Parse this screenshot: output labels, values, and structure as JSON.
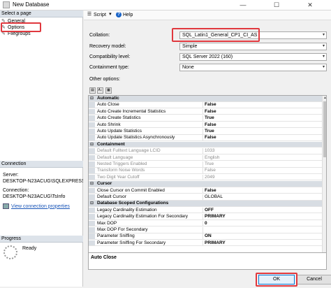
{
  "window": {
    "title": "New Database",
    "minimize": "—",
    "maximize": "☐",
    "close": "✕"
  },
  "sidebar": {
    "select_page_header": "Select a page",
    "pages": [
      {
        "label": "General"
      },
      {
        "label": "Options"
      },
      {
        "label": "Filegroups"
      }
    ],
    "connection_header": "Connection",
    "server_label": "Server:",
    "server_value": "DESKTOP-N23ACUG\\SQLEXPRESS",
    "connection_label": "Connection:",
    "connection_value": "DESKTOP-N23ACUG\\TsInfo",
    "view_connection_link": "View connection properties",
    "progress_header": "Progress",
    "progress_status": "Ready"
  },
  "toolbar": {
    "script_label": "Script",
    "help_label": "Help"
  },
  "fields": [
    {
      "label": "Collation:",
      "value": "SQL_Latin1_General_CP1_CI_AS"
    },
    {
      "label": "Recovery model:",
      "value": "Simple"
    },
    {
      "label": "Compatibility level:",
      "value": "SQL Server 2022 (160)"
    },
    {
      "label": "Containment type:",
      "value": "None"
    }
  ],
  "other_options_label": "Other options:",
  "property_grid": [
    {
      "type": "cat",
      "name": "Automatic"
    },
    {
      "type": "row",
      "name": "Auto Close",
      "value": "False",
      "bold": true
    },
    {
      "type": "row",
      "name": "Auto Create Incremental Statistics",
      "value": "False",
      "bold": true
    },
    {
      "type": "row",
      "name": "Auto Create Statistics",
      "value": "True",
      "bold": true
    },
    {
      "type": "row",
      "name": "Auto Shrink",
      "value": "False",
      "bold": true
    },
    {
      "type": "row",
      "name": "Auto Update Statistics",
      "value": "True",
      "bold": true
    },
    {
      "type": "row",
      "name": "Auto Update Statistics Asynchronously",
      "value": "False",
      "bold": true
    },
    {
      "type": "cat",
      "name": "Containment"
    },
    {
      "type": "row",
      "name": "Default Fulltext Language LCID",
      "value": "1033",
      "disabled": true
    },
    {
      "type": "row",
      "name": "Default Language",
      "value": "English",
      "disabled": true
    },
    {
      "type": "row",
      "name": "Nested Triggers Enabled",
      "value": "True",
      "disabled": true
    },
    {
      "type": "row",
      "name": "Transform Noise Words",
      "value": "False",
      "disabled": true
    },
    {
      "type": "row",
      "name": "Two Digit Year Cutoff",
      "value": "2049",
      "disabled": true
    },
    {
      "type": "cat",
      "name": "Cursor"
    },
    {
      "type": "row",
      "name": "Close Cursor on Commit Enabled",
      "value": "False",
      "bold": true
    },
    {
      "type": "row",
      "name": "Default Cursor",
      "value": "GLOBAL"
    },
    {
      "type": "cat",
      "name": "Database Scoped Configurations"
    },
    {
      "type": "row",
      "name": "Legacy Cardinality Estimation",
      "value": "OFF",
      "bold": true
    },
    {
      "type": "row",
      "name": "Legacy Cardinality Estimation For Secondary",
      "value": "PRIMARY",
      "bold": true
    },
    {
      "type": "row",
      "name": "Max DOP",
      "value": "0",
      "bold": true
    },
    {
      "type": "row",
      "name": "Max DOP For Secondary",
      "value": ""
    },
    {
      "type": "row",
      "name": "Parameter Sniffing",
      "value": "ON",
      "bold": true
    },
    {
      "type": "row",
      "name": "Parameter Sniffing For Secondary",
      "value": "PRIMARY",
      "bold": true
    }
  ],
  "description": "Auto Close",
  "buttons": {
    "ok": "OK",
    "cancel": "Cancel"
  },
  "colors": {
    "highlight": "#e0383e",
    "category_bg": "#d8dde3"
  }
}
